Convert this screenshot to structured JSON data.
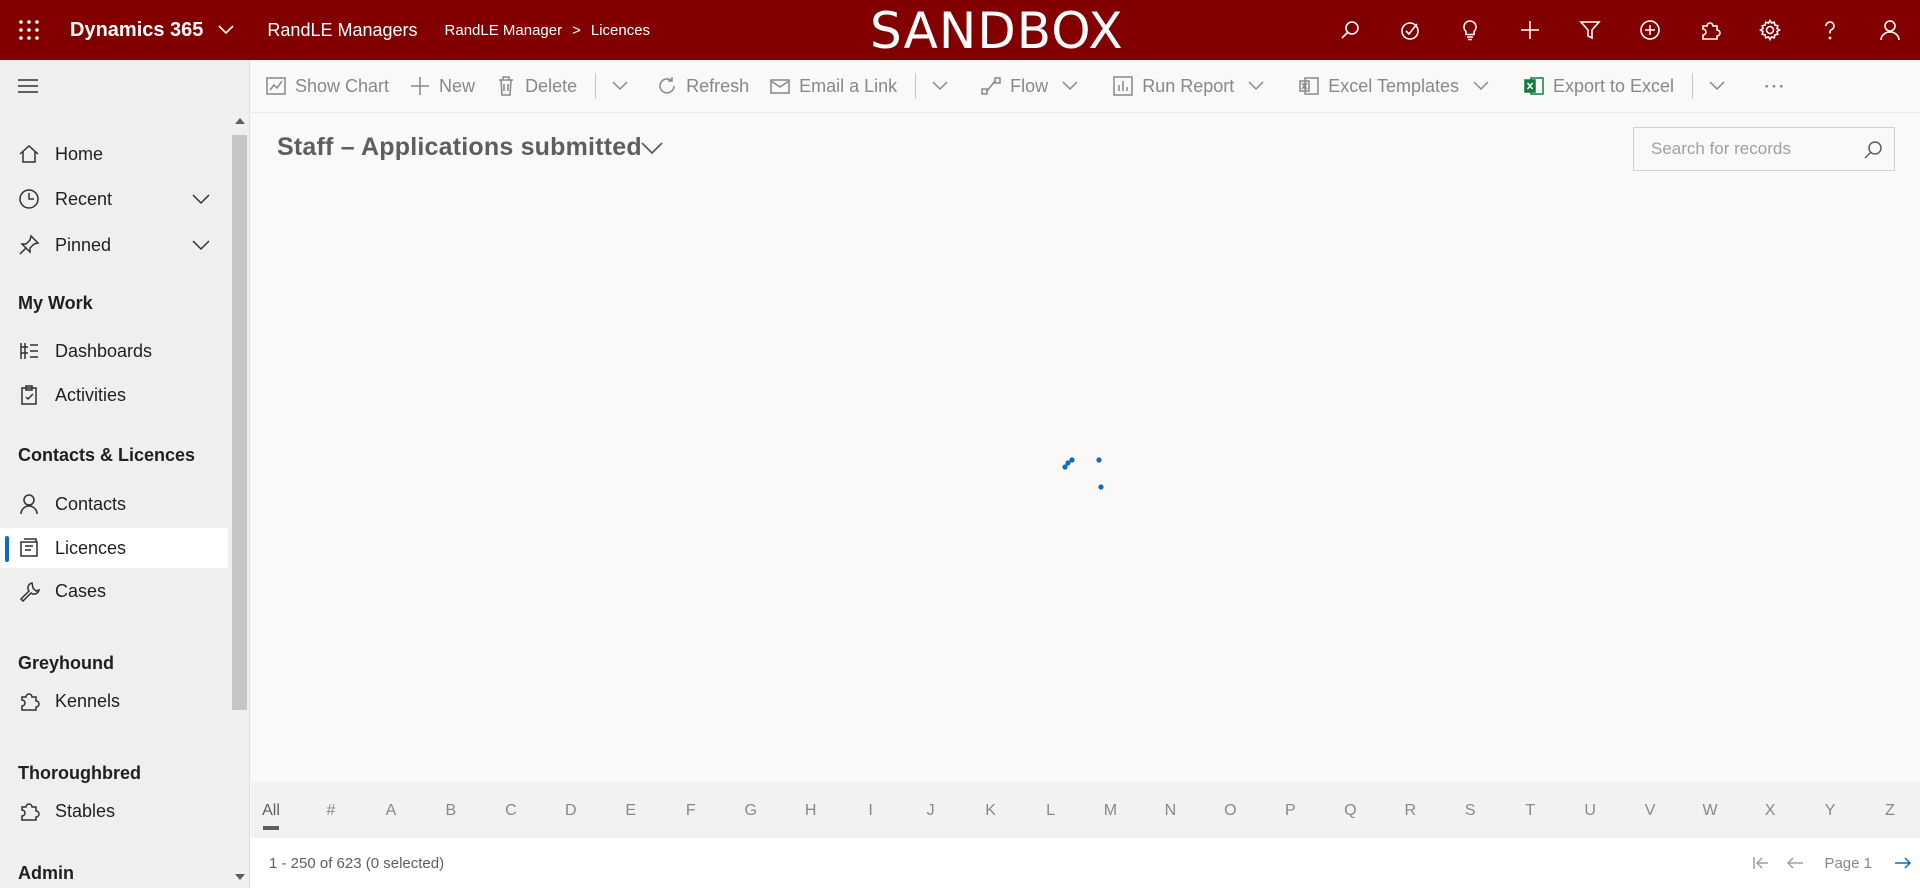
{
  "topbar": {
    "app_name": "Dynamics 365",
    "app_area": "RandLE Managers",
    "breadcrumb": [
      "RandLE Manager",
      "Licences"
    ],
    "banner": "SANDBOX",
    "icons": [
      "search-icon",
      "task-icon",
      "lightbulb-icon",
      "plus-icon",
      "filter-icon",
      "circle-plus-icon",
      "puzzle-icon",
      "settings-icon",
      "help-icon",
      "user-icon"
    ],
    "background": "#820000"
  },
  "sidebar": {
    "items": [
      {
        "label": "Home",
        "icon": "home-icon"
      },
      {
        "label": "Recent",
        "icon": "clock-icon"
      },
      {
        "label": "Pinned",
        "icon": "pin-icon"
      },
      {
        "label": "Dashboards",
        "icon": "dashboard-icon"
      },
      {
        "label": "Activities",
        "icon": "clipboard-icon"
      },
      {
        "label": "Contacts",
        "icon": "person-icon"
      },
      {
        "label": "Licences",
        "icon": "licence-icon"
      },
      {
        "label": "Cases",
        "icon": "wrench-icon"
      },
      {
        "label": "Kennels",
        "icon": "puzzle-icon"
      },
      {
        "label": "Stables",
        "icon": "puzzle-icon"
      }
    ],
    "groups": [
      "My Work",
      "Contacts & Licences",
      "Greyhound",
      "Thoroughbred",
      "Admin"
    ],
    "active_item": "Licences"
  },
  "commandbar": {
    "show_chart": "Show Chart",
    "new": "New",
    "delete": "Delete",
    "refresh": "Refresh",
    "email_link": "Email a Link",
    "flow": "Flow",
    "run_report": "Run Report",
    "excel_templates": "Excel Templates",
    "export_excel": "Export to Excel",
    "more": "⋯"
  },
  "view": {
    "title": "Staff – Applications submitted",
    "search_placeholder": "Search for records"
  },
  "jumpbar": {
    "letters": [
      "All",
      "#",
      "A",
      "B",
      "C",
      "D",
      "E",
      "F",
      "G",
      "H",
      "I",
      "J",
      "K",
      "L",
      "M",
      "N",
      "O",
      "P",
      "Q",
      "R",
      "S",
      "T",
      "U",
      "V",
      "W",
      "X",
      "Y",
      "Z"
    ],
    "active": "All"
  },
  "footer": {
    "record_count": "1 - 250 of 623 (0 selected)",
    "page_label": "Page 1"
  },
  "colors": {
    "accent": "#0f6cbd",
    "topbar": "#820000"
  }
}
